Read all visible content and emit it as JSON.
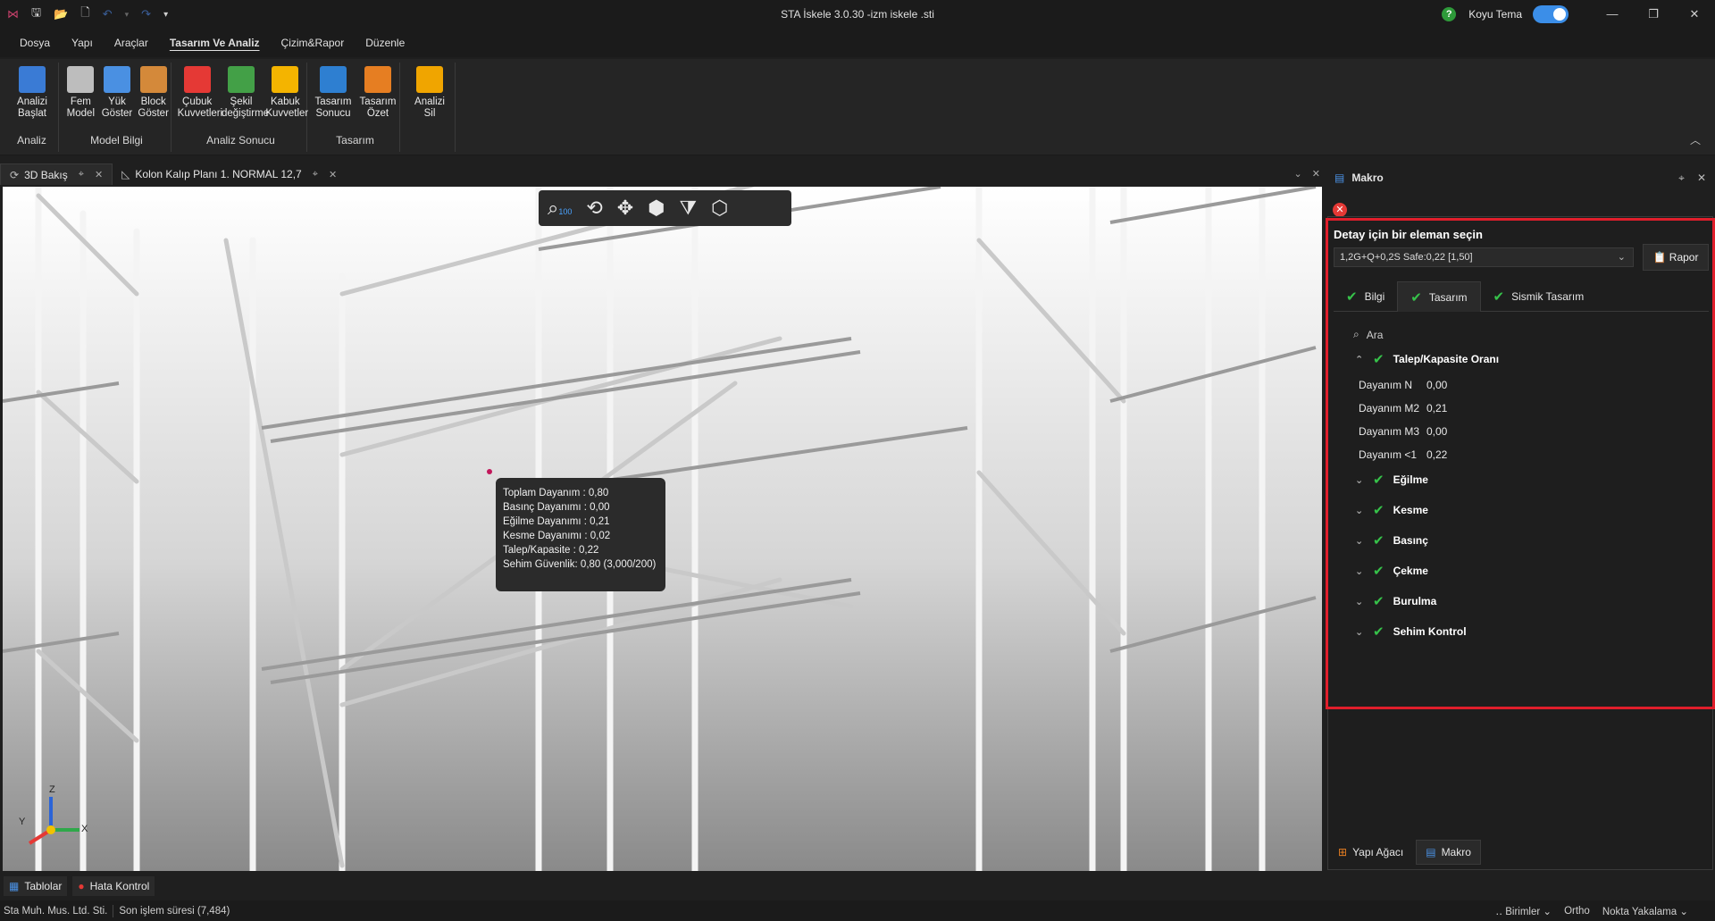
{
  "title_bar": {
    "app_title": "STA İskele 3.0.30 -izm iskele .sti",
    "theme_label": "Koyu Tema",
    "help_label": "?"
  },
  "menu": {
    "items": [
      "Dosya",
      "Yapı",
      "Araçlar",
      "Tasarım Ve Analiz",
      "Çizim&Rapor",
      "Düzenle"
    ],
    "active_index": 3
  },
  "ribbon": {
    "groups": [
      {
        "label": "Analiz",
        "buttons": [
          {
            "l1": "Analizi",
            "l2": "Başlat",
            "icon": "calculator-icon",
            "color": "#3a7bd5"
          }
        ]
      },
      {
        "label": "Model Bilgi",
        "buttons": [
          {
            "l1": "Fem",
            "l2": "Model",
            "icon": "mesh-icon",
            "color": "#bdbdbd"
          },
          {
            "l1": "Yük",
            "l2": "Göster",
            "icon": "download-arrow-icon",
            "color": "#4a90e2"
          },
          {
            "l1": "Block",
            "l2": "Göster",
            "icon": "blocks-icon",
            "color": "#d4893a"
          }
        ]
      },
      {
        "label": "Analiz Sonucu",
        "buttons": [
          {
            "l1": "Çubuk",
            "l2": "Kuvvetleri",
            "icon": "bar-forces-icon",
            "color": "#e53935"
          },
          {
            "l1": "Şekil",
            "l2": "değiştirme",
            "icon": "deformation-icon",
            "color": "#43a047"
          },
          {
            "l1": "Kabuk",
            "l2": "Kuvvetler",
            "icon": "shell-forces-icon",
            "color": "#f4b400"
          }
        ]
      },
      {
        "label": "Tasarım",
        "buttons": [
          {
            "l1": "Tasarım",
            "l2": "Sonucu",
            "icon": "sigma-icon",
            "color": "#2e7fd1"
          },
          {
            "l1": "Tasarım",
            "l2": "Özet",
            "icon": "summary-chart-icon",
            "color": "#e67e22"
          }
        ]
      },
      {
        "label": "",
        "buttons": [
          {
            "l1": "Analizi",
            "l2": "Sil",
            "icon": "lock-icon",
            "color": "#f0a500"
          }
        ]
      }
    ]
  },
  "doc_tabs": [
    {
      "label": "3D Bakış",
      "icon": "3d-view-icon",
      "active": true
    },
    {
      "label": "Kolon Kalıp Planı 1. NORMAL 12,7",
      "icon": "plan-icon",
      "active": false
    }
  ],
  "viewport": {
    "toolbar_zoom": "100",
    "tooltip": [
      "Toplam Dayanım : 0,80",
      "Basınç Dayanımı : 0,00",
      "Eğilme Dayanımı : 0,21",
      "Kesme Dayanımı : 0,02",
      "Talep/Kapasite : 0,22",
      "Sehim Güvenlik: 0,80 (3,000/200)"
    ],
    "axes": {
      "x": "X",
      "y": "Y",
      "z": "Z"
    }
  },
  "right_panel": {
    "title": "Makro",
    "detail_title": "Detay için bir eleman seçin",
    "combo_value": "1,2G+Q+0,2S Safe:0,22 [1,50]",
    "rapor_label": "Rapor",
    "tabs": [
      "Bilgi",
      "Tasarım",
      "Sismik Tasarım"
    ],
    "active_tab": 1,
    "search_placeholder": "Ara",
    "expanded_section": {
      "title": "Talep/Kapasite Oranı",
      "rows": [
        {
          "k": "Dayanım N",
          "v": "0,00"
        },
        {
          "k": "Dayanım M2",
          "v": "0,21"
        },
        {
          "k": "Dayanım M3",
          "v": "0,00"
        },
        {
          "k": "Dayanım <1",
          "v": "0,22"
        }
      ]
    },
    "collapsed_sections": [
      "Eğilme",
      "Kesme",
      "Basınç",
      "Çekme",
      "Burulma",
      "Sehim Kontrol"
    ],
    "bottom_tabs": [
      "Yapı Ağacı",
      "Makro"
    ]
  },
  "bottom_bar": {
    "tablolar": "Tablolar",
    "hata_kontrol": "Hata Kontrol"
  },
  "status_bar": {
    "company": "Sta Muh. Mus. Ltd. Sti.",
    "last_op": "Son işlem süresi (7,484)",
    "units": "Birimler",
    "ortho": "Ortho",
    "snap": "Nokta Yakalama"
  }
}
